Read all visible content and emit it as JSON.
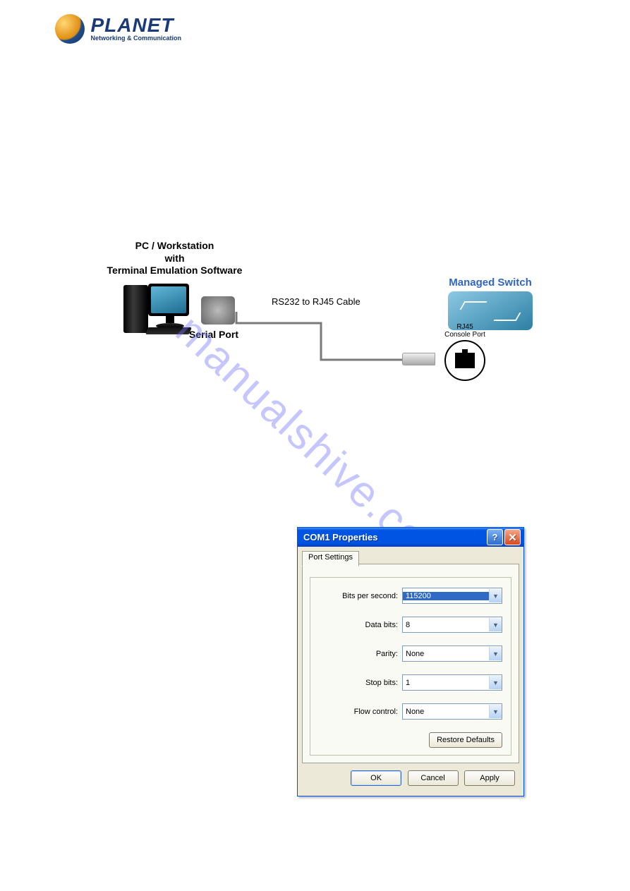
{
  "logo": {
    "brand": "PLANET",
    "tag": "Networking & Communication"
  },
  "watermark": "manualshive.com",
  "diagram": {
    "pc_title_l1": "PC / Workstation",
    "pc_title_l2": "with",
    "pc_title_l3": "Terminal Emulation Software",
    "serial_port": "Serial Port",
    "cable_label": "RS232 to RJ45 Cable",
    "managed_switch": "Managed Switch",
    "port_l1": "RJ45",
    "port_l2": "Console Port"
  },
  "dialog": {
    "title": "COM1 Properties",
    "tab": "Port Settings",
    "rows": {
      "bps_label": "Bits per second:",
      "bps_value": "115200",
      "databits_label": "Data bits:",
      "databits_value": "8",
      "parity_label": "Parity:",
      "parity_value": "None",
      "stopbits_label": "Stop bits:",
      "stopbits_value": "1",
      "flow_label": "Flow control:",
      "flow_value": "None"
    },
    "restore": "Restore Defaults",
    "ok": "OK",
    "cancel": "Cancel",
    "apply": "Apply"
  }
}
